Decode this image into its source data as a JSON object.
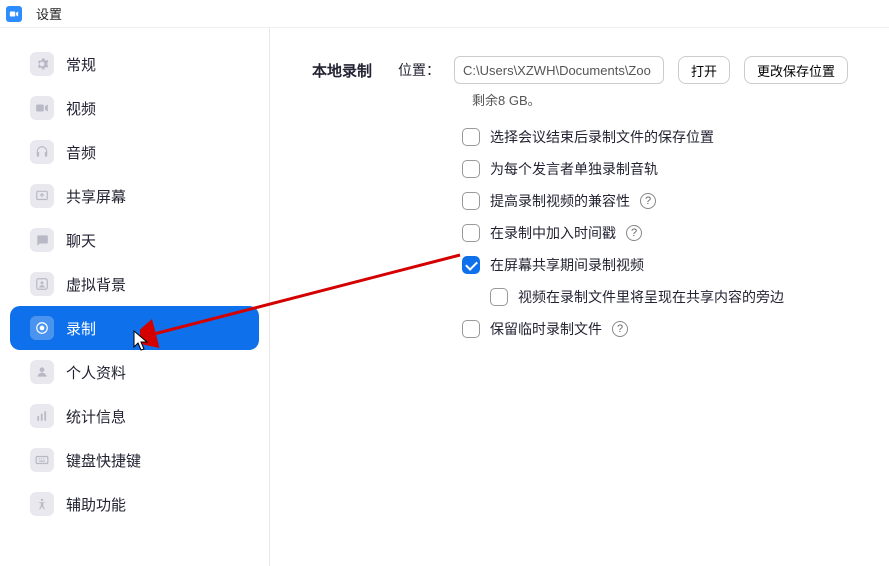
{
  "titlebar": {
    "title": "设置"
  },
  "sidebar": {
    "items": [
      {
        "id": "general",
        "label": "常规"
      },
      {
        "id": "video",
        "label": "视频"
      },
      {
        "id": "audio",
        "label": "音频"
      },
      {
        "id": "share",
        "label": "共享屏幕"
      },
      {
        "id": "chat",
        "label": "聊天"
      },
      {
        "id": "vbg",
        "label": "虚拟背景"
      },
      {
        "id": "recording",
        "label": "录制",
        "selected": true
      },
      {
        "id": "profile",
        "label": "个人资料"
      },
      {
        "id": "stats",
        "label": "统计信息"
      },
      {
        "id": "shortcut",
        "label": "键盘快捷键"
      },
      {
        "id": "a11y",
        "label": "辅助功能"
      }
    ]
  },
  "content": {
    "section_title": "本地录制",
    "location_label": "位置：",
    "location_value": "C:\\Users\\XZWH\\Documents\\Zoo",
    "open_btn": "打开",
    "change_btn": "更改保存位置",
    "remaining": "剩余8 GB。",
    "opts": {
      "choose_after": "选择会议结束后录制文件的保存位置",
      "per_speaker": "为每个发言者单独录制音轨",
      "compat": "提高录制视频的兼容性",
      "timestamp": "在录制中加入时间戳",
      "screen_share": "在屏幕共享期间录制视频",
      "beside_content": "视频在录制文件里将呈现在共享内容的旁边",
      "keep_temp": "保留临时录制文件"
    }
  }
}
